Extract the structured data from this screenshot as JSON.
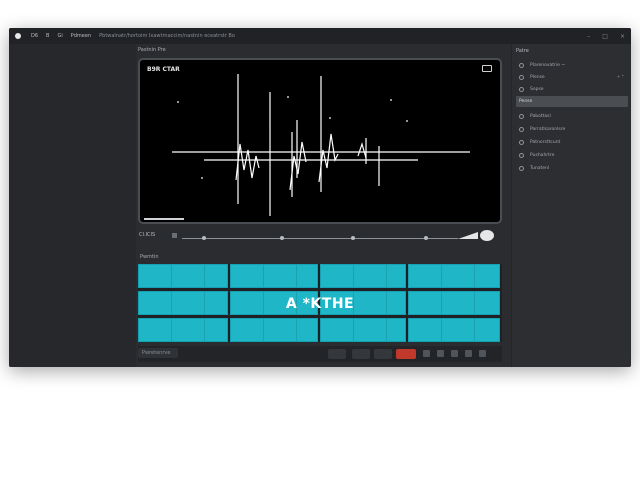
{
  "titlebar": {
    "items": [
      "D6",
      "B",
      "Gi"
    ],
    "app_label": "Pdmeen",
    "path": "Pbtwalnatr/hortoim Ixawtrnaccim/nastnin eceatrstr Bo"
  },
  "viewer": {
    "section_label": "Pastnin Pre",
    "overlay_label": "B9R CTAR",
    "playhead_fraction": 0.12
  },
  "scrubber": {
    "time": "CI.ICIS"
  },
  "timeline": {
    "section_label": "Pwmtin",
    "caption": "A *KTHE"
  },
  "bottombar": {
    "search_label": "Pwretenrve"
  },
  "panel": {
    "title": "Patre",
    "rows": [
      {
        "label": "Plarenovatrie ~",
        "right": ""
      },
      {
        "label": "Plense",
        "right": "+ *"
      },
      {
        "label": "Sopse",
        "right": ""
      },
      {
        "label": "Pense",
        "right": ""
      },
      {
        "label": "Pabottasl",
        "right": ""
      },
      {
        "label": "Parratlsaronlsre",
        "right": ""
      },
      {
        "label": "Patnorsttcunt",
        "right": ""
      },
      {
        "label": "Pushahrtre",
        "right": ""
      },
      {
        "label": "Tunatenl",
        "right": ""
      }
    ]
  },
  "colors": {
    "accent_clip": "#1fb7c7",
    "record": "#c0392b"
  }
}
